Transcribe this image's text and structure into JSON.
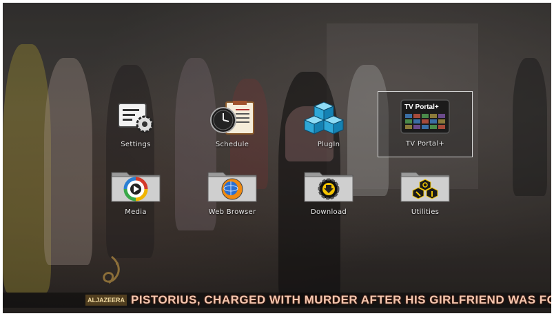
{
  "menu": {
    "items": [
      {
        "label": "Settings",
        "icon": "settings-gear-icon"
      },
      {
        "label": "Schedule",
        "icon": "schedule-clock-icon"
      },
      {
        "label": "PlugIn",
        "icon": "plugin-cubes-icon"
      },
      {
        "label": "TV Portal+",
        "icon": "tv-portal-icon",
        "selected": true
      },
      {
        "label": "Media",
        "icon": "media-play-folder-icon"
      },
      {
        "label": "Web Browser",
        "icon": "web-browser-folder-icon"
      },
      {
        "label": "Download",
        "icon": "download-folder-icon"
      },
      {
        "label": "Utilities",
        "icon": "utilities-folder-icon"
      }
    ]
  },
  "tv_portal_logo_text": "TV Portal+",
  "ticker": {
    "logo": "ALJAZEERA",
    "text": "PISTORIUS, CHARGED WITH MURDER AFTER HIS GIRLFRIEND WAS FOUND"
  },
  "colors": {
    "selection_border": "#d8d8d8",
    "ticker_text": "#f3c7b0"
  }
}
